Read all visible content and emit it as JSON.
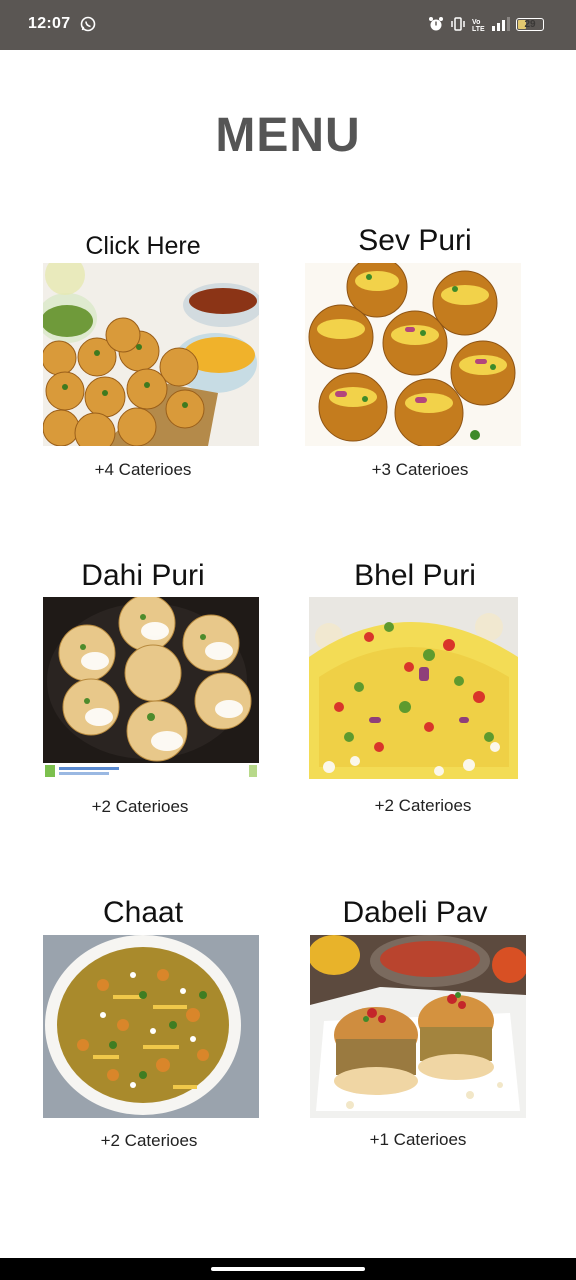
{
  "status_bar": {
    "time": "12:07",
    "battery_level": "29",
    "icons": [
      "whatsapp-icon",
      "alarm-icon",
      "vibrate-icon",
      "volte-icon",
      "signal-icon",
      "battery-icon"
    ]
  },
  "menu": {
    "title": "MENU",
    "items": [
      {
        "name": "Click Here",
        "categories": "+4 Caterioes",
        "image": "pani-puri-photo"
      },
      {
        "name": "Sev Puri",
        "categories": "+3 Caterioes",
        "image": "sev-puri-photo"
      },
      {
        "name": "Dahi Puri",
        "categories": "+2 Caterioes",
        "image": "dahi-puri-photo"
      },
      {
        "name": "Bhel Puri",
        "categories": "+2 Caterioes",
        "image": "bhel-puri-photo"
      },
      {
        "name": "Chaat",
        "categories": "+2 Caterioes",
        "image": "chaat-photo"
      },
      {
        "name": "Dabeli Pav",
        "categories": "+1 Caterioes",
        "image": "dabeli-pav-photo"
      }
    ]
  },
  "colors": {
    "status_bar_bg": "#5a5653",
    "title_color": "#555555",
    "nav_bar_bg": "#000000"
  }
}
